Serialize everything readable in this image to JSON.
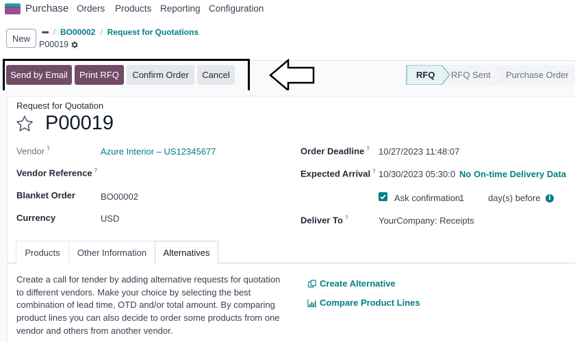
{
  "nav": {
    "app_name": "Purchase",
    "menu": [
      "Orders",
      "Products",
      "Reporting",
      "Configuration"
    ]
  },
  "control_panel": {
    "new_label": "New",
    "breadcrumb": {
      "ellipsis": "•••",
      "items": [
        "BO00002",
        "Request for Quotations"
      ]
    },
    "record_name": "P00019"
  },
  "actions": {
    "send_email": "Send by Email",
    "print_rfq": "Print RFQ",
    "confirm_order": "Confirm Order",
    "cancel": "Cancel"
  },
  "status": {
    "stages": [
      "RFQ",
      "RFQ Sent",
      "Purchase Order"
    ],
    "active": "RFQ"
  },
  "form": {
    "doc_type": "Request for Quotation",
    "doc_name": "P00019",
    "fields_left": [
      {
        "label": "Vendor",
        "help": "?",
        "value": "Azure Interior – US12345677"
      },
      {
        "label": "Vendor Reference",
        "help": "?",
        "value": ""
      },
      {
        "label": "Blanket Order",
        "value": "BO00002"
      },
      {
        "label": "Currency",
        "value": "USD"
      }
    ],
    "fields_right": [
      {
        "label": "Order Deadline",
        "help": "?",
        "value": "10/27/2023 11:48:07"
      },
      {
        "label": "Expected Arrival",
        "help": "?",
        "value": "10/30/2023 05:30:0",
        "extra": "No On-time Delivery Data"
      },
      {
        "label": "Ask confirmation",
        "checked": true,
        "days": "1",
        "suffix": "day(s) before"
      },
      {
        "label": "Deliver To",
        "help": "?",
        "value": "YourCompany: Receipts"
      }
    ]
  },
  "tabs": {
    "items": [
      "Products",
      "Other Information",
      "Alternatives"
    ],
    "active": "Alternatives"
  },
  "alternatives": {
    "description": "Create a call for tender by adding alternative requests for quotation to different vendors. Make your choice by selecting the best combination of lead time, OTD and/or total amount. By comparing product lines you can also decide to order some products from one vendor and others from another vendor.",
    "create_label": "Create Alternative",
    "compare_label": "Compare Product Lines"
  },
  "colors": {
    "primary": "#714b67",
    "link": "#017e84",
    "secondary_btn": "#e5e7eb"
  }
}
